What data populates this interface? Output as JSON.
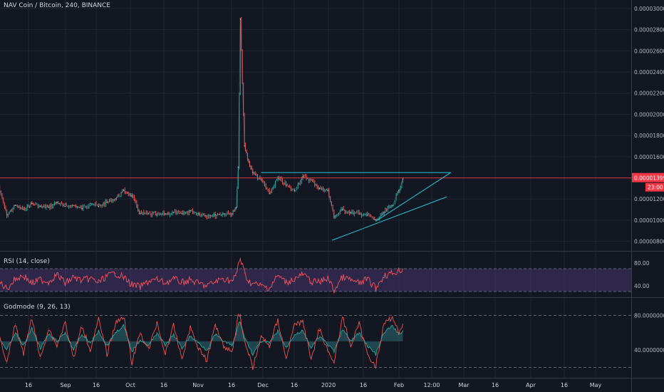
{
  "header": {
    "symbol": "NAV Coin / Bitcoin, 240, BINANCE",
    "rsi_label": "RSI (14, close)",
    "godmode_label": "Godmode (9, 26, 13)"
  },
  "colors": {
    "background": "#131722",
    "grid": "#2a2e39",
    "up": "#26a69a",
    "down": "#ef5350",
    "trendline": "#26c6da",
    "price_line": "#f23645",
    "rsi": "#f7525f",
    "rsi_band": "#7e57c2",
    "godmode_fast": "#ef5350",
    "godmode_slow": "#26a69a",
    "godmode_area": "#2e6b73",
    "text": "#b2b5be"
  },
  "chart_data": [
    {
      "type": "candlestick",
      "title": "NAV Coin / Bitcoin, 240, BINANCE",
      "xlabel": "",
      "ylabel": "",
      "x_ticks": [
        "16",
        "Sep",
        "16",
        "Oct",
        "16",
        "Nov",
        "16",
        "Dec",
        "16",
        "2020",
        "16",
        "Feb",
        "12:00",
        "Mar",
        "16",
        "Apr",
        "16",
        "May"
      ],
      "y_ticks": [
        "0.00000800",
        "0.00001000",
        "0.00001200",
        "0.00001400",
        "0.00001600",
        "0.00001800",
        "0.00002000",
        "0.00002200",
        "0.00002400",
        "0.00002600",
        "0.00002800",
        "0.00003000"
      ],
      "ylim": [
        7.1e-06,
        3.08e-05
      ],
      "last_price": "0.00001399",
      "countdown": "23:00",
      "horizontal_line": 1.399e-05,
      "series": [
        {
          "name": "close",
          "x": [
            "Aug 1",
            "Aug 5",
            "Aug 9",
            "Aug 13",
            "Aug 17",
            "Aug 21",
            "Aug 25",
            "Aug 29",
            "Sep 2",
            "Sep 6",
            "Sep 10",
            "Sep 14",
            "Sep 18",
            "Sep 22",
            "Sep 26",
            "Sep 30",
            "Oct 4",
            "Oct 8",
            "Oct 12",
            "Oct 16",
            "Oct 20",
            "Oct 24",
            "Oct 28",
            "Nov 1",
            "Nov 5",
            "Nov 9",
            "Nov 13",
            "Nov 17",
            "Nov 21",
            "Nov 23",
            "Nov 24",
            "Nov 25",
            "Nov 27",
            "Nov 29",
            "Dec 1",
            "Dec 5",
            "Dec 9",
            "Dec 13",
            "Dec 17",
            "Dec 21",
            "Dec 25",
            "Dec 29",
            "Jan 2",
            "Jan 6",
            "Jan 9",
            "Jan 13",
            "Jan 17",
            "Jan 21",
            "Jan 25",
            "Jan 29",
            "Feb 2",
            "Feb 6",
            "Feb 9",
            "Feb 11"
          ],
          "values": [
            1.32e-05,
            1.05e-05,
            1.14e-05,
            1.1e-05,
            1.16e-05,
            1.13e-05,
            1.12e-05,
            1.17e-05,
            1.13e-05,
            1.14e-05,
            1.11e-05,
            1.16e-05,
            1.13e-05,
            1.17e-05,
            1.2e-05,
            1.28e-05,
            1.23e-05,
            1.06e-05,
            1.06e-05,
            1.05e-05,
            1.06e-05,
            1.07e-05,
            1.06e-05,
            1.09e-05,
            1.06e-05,
            1.04e-05,
            1.05e-05,
            1.06e-05,
            1.06e-05,
            1.12e-05,
            1.5e-05,
            2.9e-05,
            1.7e-05,
            1.55e-05,
            1.45e-05,
            1.38e-05,
            1.25e-05,
            1.4e-05,
            1.33e-05,
            1.28e-05,
            1.41e-05,
            1.38e-05,
            1.3e-05,
            1.28e-05,
            1.03e-05,
            1.1e-05,
            1.07e-05,
            1.06e-05,
            1.05e-05,
            1e-05,
            1.07e-05,
            1.14e-05,
            1.28e-05,
            1.39e-05
          ]
        }
      ],
      "trendlines": [
        {
          "from": [
            "Dec 5",
            1.45e-05
          ],
          "to": [
            "Mar 5",
            1.45e-05
          ]
        },
        {
          "from": [
            "Jan 8",
            8.1e-06
          ],
          "to": [
            "Mar 3",
            1.22e-05
          ]
        },
        {
          "from": [
            "Jan 29",
            9.9e-06
          ],
          "to": [
            "Mar 5",
            1.45e-05
          ]
        }
      ]
    },
    {
      "type": "line",
      "title": "RSI (14, close)",
      "y_ticks": [
        "40.00",
        "80.00"
      ],
      "ylim": [
        20,
        100
      ],
      "band": [
        30,
        70
      ],
      "series": [
        {
          "name": "RSI",
          "values": [
            48,
            35,
            52,
            58,
            44,
            51,
            47,
            60,
            45,
            55,
            49,
            53,
            46,
            57,
            62,
            55,
            42,
            38,
            48,
            51,
            45,
            52,
            46,
            50,
            44,
            40,
            47,
            53,
            48,
            58,
            78,
            88,
            62,
            48,
            44,
            40,
            36,
            58,
            46,
            52,
            60,
            48,
            46,
            54,
            32,
            55,
            50,
            44,
            52,
            36,
            58,
            62,
            66,
            70
          ]
        }
      ]
    },
    {
      "type": "line",
      "title": "Godmode (9, 26, 13)",
      "y_ticks": [
        "40.00000000",
        "80.00000000"
      ],
      "ylim": [
        8,
        100
      ],
      "levels": [
        20,
        80
      ],
      "series": [
        {
          "name": "fast",
          "values": [
            60,
            25,
            70,
            35,
            78,
            30,
            65,
            45,
            72,
            30,
            68,
            40,
            75,
            35,
            70,
            80,
            25,
            60,
            40,
            72,
            35,
            68,
            30,
            66,
            42,
            28,
            70,
            45,
            38,
            65,
            80,
            78,
            50,
            35,
            20,
            55,
            45,
            75,
            30,
            70,
            72,
            30,
            65,
            40,
            25,
            78,
            45,
            70,
            35,
            22,
            70,
            78,
            60,
            70
          ]
        },
        {
          "name": "slow",
          "values": [
            55,
            40,
            60,
            45,
            65,
            42,
            58,
            50,
            60,
            40,
            58,
            48,
            62,
            45,
            60,
            68,
            38,
            52,
            45,
            60,
            45,
            58,
            42,
            56,
            48,
            40,
            58,
            50,
            45,
            58,
            70,
            72,
            55,
            45,
            35,
            50,
            48,
            62,
            42,
            58,
            62,
            42,
            56,
            46,
            38,
            64,
            50,
            60,
            45,
            35,
            60,
            68,
            58,
            62
          ]
        }
      ]
    }
  ]
}
